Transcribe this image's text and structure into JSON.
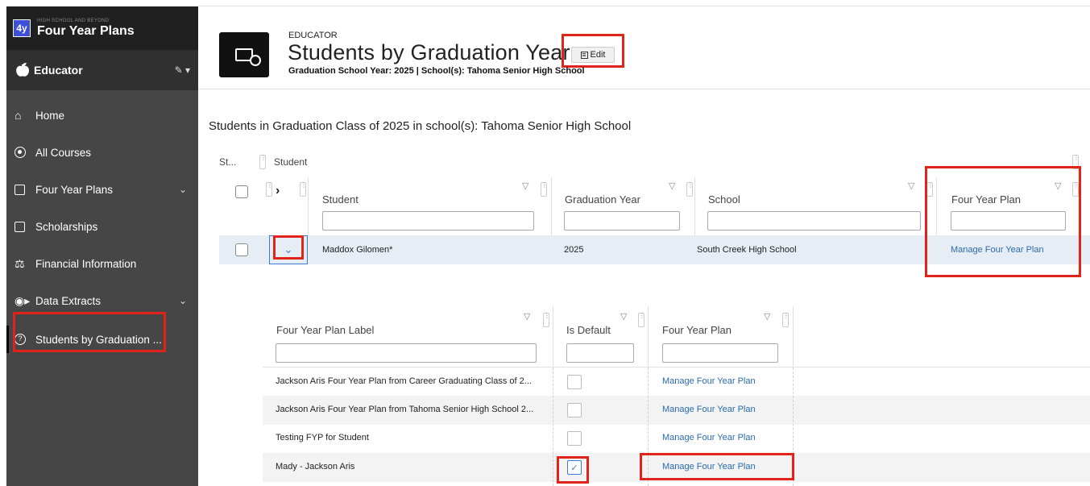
{
  "brand": {
    "logo": "4y",
    "subtitle": "HIGH SCHOOL AND BEYOND",
    "title": "Four Year Plans"
  },
  "role": {
    "label": "Educator",
    "icon": "apple-icon"
  },
  "sidebar": {
    "items": [
      {
        "label": "Home",
        "icon": "home-icon"
      },
      {
        "label": "All Courses",
        "icon": "circle-dot-icon"
      },
      {
        "label": "Four Year Plans",
        "icon": "plan-icon"
      },
      {
        "label": "Scholarships",
        "icon": "scholarship-icon"
      },
      {
        "label": "Financial Information",
        "icon": "finance-icon"
      },
      {
        "label": "Data Extracts",
        "icon": "data-extract-icon"
      },
      {
        "label": "Students by Graduation ...",
        "icon": "help-circle-icon"
      }
    ]
  },
  "header": {
    "eyebrow": "EDUCATOR",
    "title": "Students by Graduation Year",
    "edit_label": "Edit",
    "subtitle": "Graduation School Year: 2025 | School(s): Tahoma Senior High School"
  },
  "section_title": "Students in Graduation Class of 2025 in school(s): Tahoma Senior High School",
  "grid": {
    "group_row": {
      "col1": "St...",
      "col2": "Student"
    },
    "columns": [
      "Student",
      "Graduation Year",
      "School",
      "Four Year Plan"
    ],
    "rows": [
      {
        "student": "Maddox Gilomen*",
        "graduation_year": "2025",
        "school": "South Creek High School",
        "plan_link": "Manage Four Year Plan"
      }
    ]
  },
  "detail": {
    "columns": [
      "Four Year Plan Label",
      "Is Default",
      "Four Year Plan"
    ],
    "rows": [
      {
        "label": "Jackson Aris Four Year Plan from Career Graduating Class of 2...",
        "is_default": false,
        "link": "Manage Four Year Plan"
      },
      {
        "label": "Jackson Aris Four Year Plan from Tahoma Senior High School 2...",
        "is_default": false,
        "link": "Manage Four Year Plan"
      },
      {
        "label": "Testing FYP for Student",
        "is_default": false,
        "link": "Manage Four Year Plan"
      },
      {
        "label": "Mady - Jackson Aris",
        "is_default": true,
        "link": "Manage Four Year Plan"
      }
    ]
  },
  "colors": {
    "sidebar_bg": "#464646",
    "brand_bg": "#202020",
    "link": "#2a6bb0",
    "highlight": "#e2231a",
    "selected_row": "#e6edf5"
  }
}
